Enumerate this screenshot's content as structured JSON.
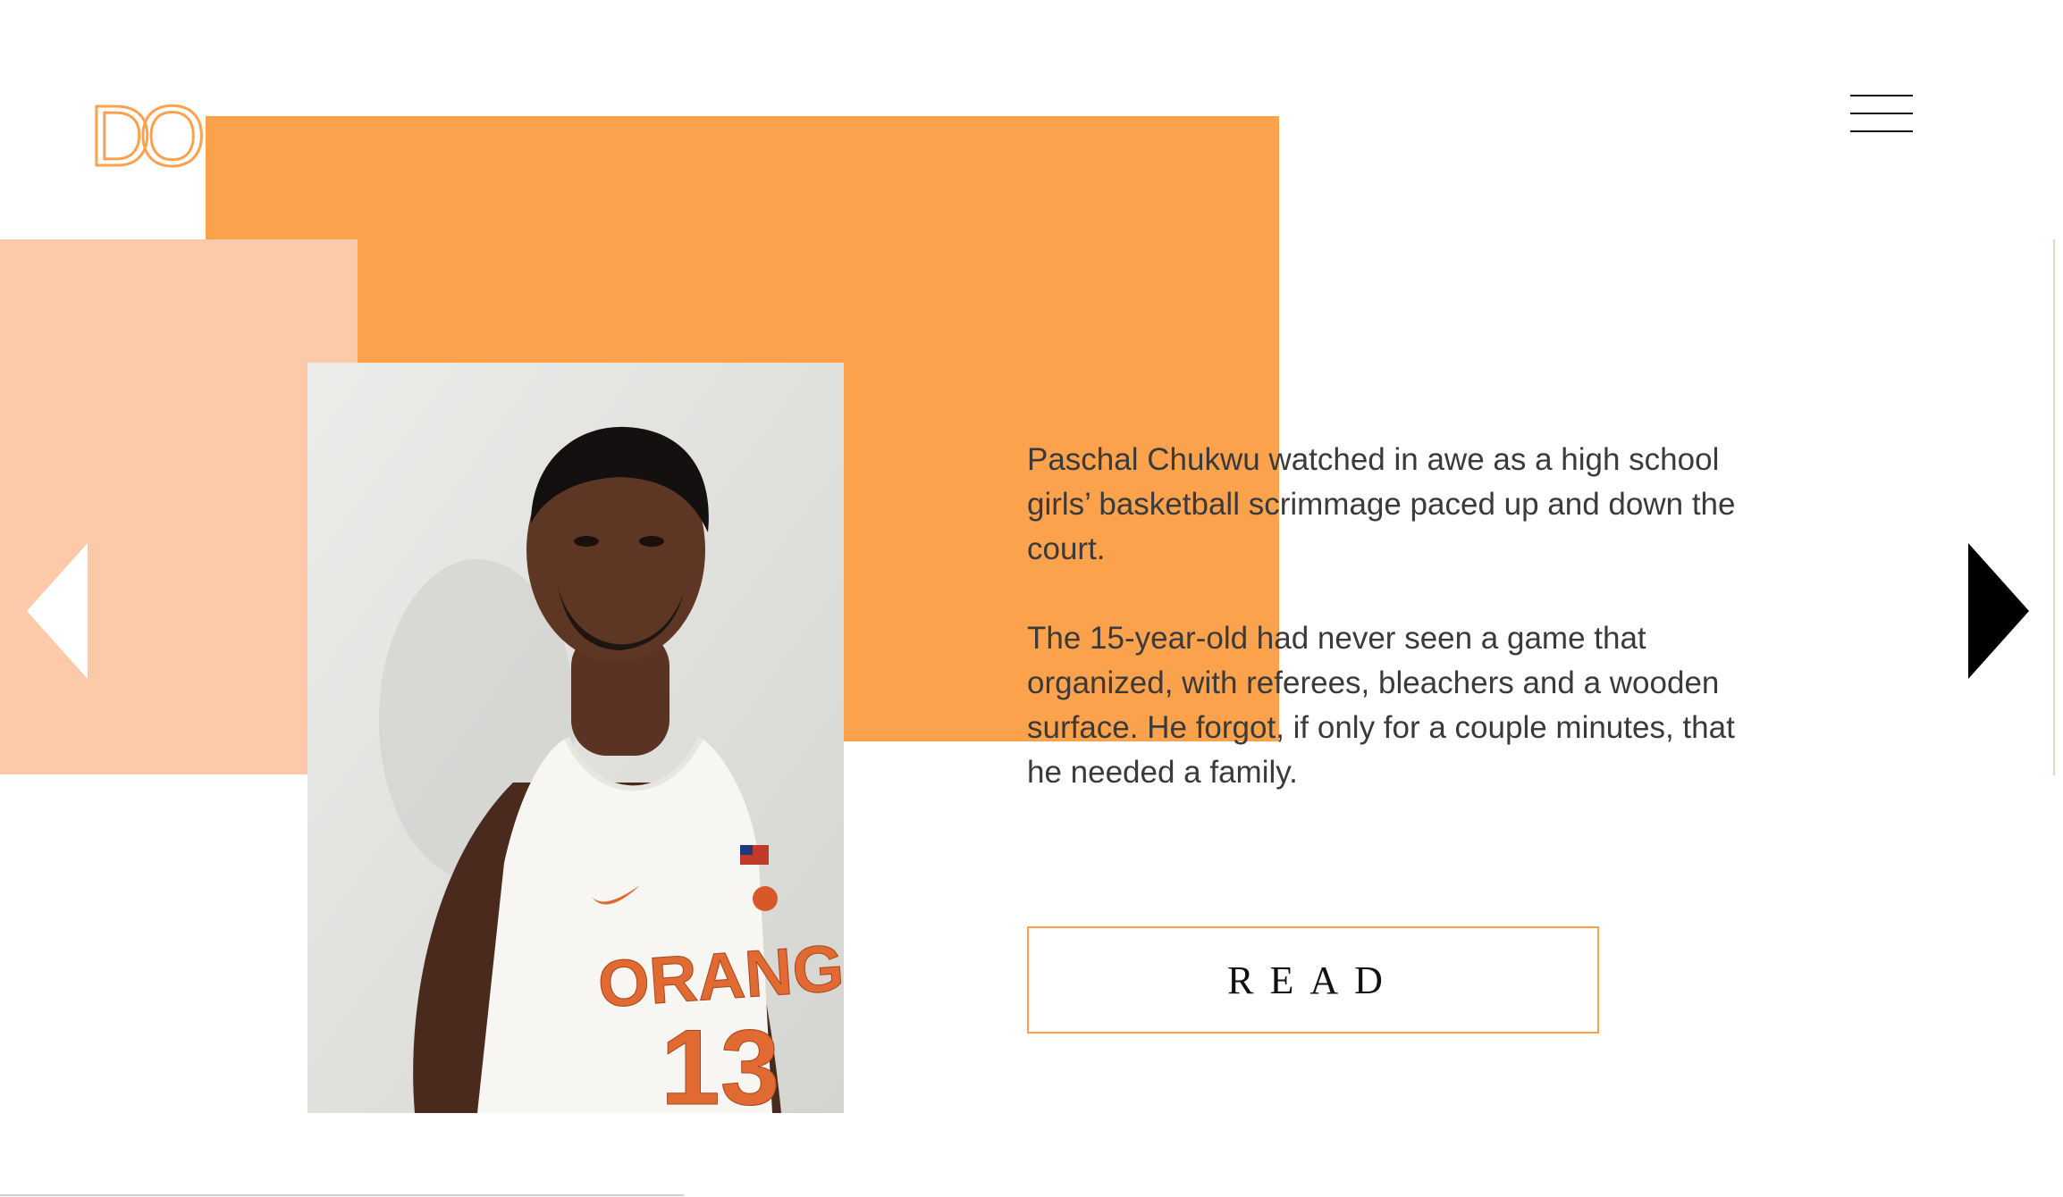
{
  "logo": {
    "text": "DO",
    "icon": "do-logo-icon"
  },
  "menu": {
    "icon": "hamburger-menu-icon"
  },
  "article": {
    "paragraphs": [
      "Paschal Chukwu watched in awe as a high school girls’ basketball scrimmage paced up and down the court.",
      "The 15-year-old had never seen a game that organized, with referees, bleachers and a wooden surface. He forgot, if only for a couple minutes, that he needed a family."
    ]
  },
  "photo": {
    "jersey_text": "ORANGE",
    "jersey_number": "13"
  },
  "read_button": {
    "label": "READ"
  },
  "nav": {
    "prev_icon": "triangle-left-icon",
    "next_icon": "triangle-right-icon"
  },
  "colors": {
    "orange": "#fca24d",
    "peach": "#fccaa9",
    "text": "#3a3a3a"
  }
}
